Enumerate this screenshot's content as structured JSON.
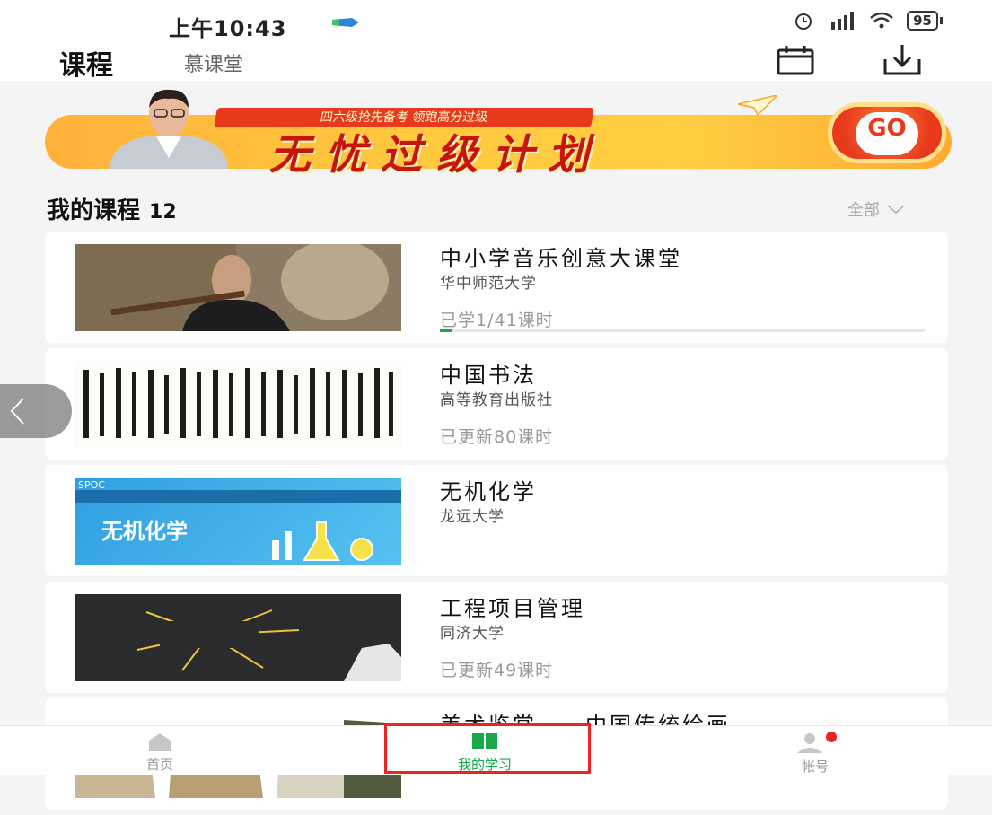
{
  "status_bar": {
    "time": "上午10:43",
    "battery": "95"
  },
  "header": {
    "title": "课程",
    "subtitle": "慕课堂"
  },
  "banner": {
    "tagline": "四六级抢先备考 领跑高分过级",
    "headline": "无忧过级计划",
    "go_label": "GO",
    "go_arrows": ">>>>"
  },
  "section": {
    "title": "我的课程",
    "count": "12",
    "filter_label": "全部"
  },
  "courses": [
    {
      "title": "中小学音乐创意大课堂",
      "school": "华中师范大学",
      "progress_text": "已学1/41课时",
      "progress": 0.024
    },
    {
      "title": "中国书法",
      "school": "高等教育出版社",
      "progress_text": "已更新80课时"
    },
    {
      "title": "无机化学",
      "school": "龙远大学",
      "progress_text": "",
      "thumb_badge": "SPOC",
      "thumb_text": "无机化学"
    },
    {
      "title": "工程项目管理",
      "school": "同济大学",
      "progress_text": "已更新49课时"
    },
    {
      "title": "美术鉴赏——中国传统绘画...",
      "school": "",
      "progress_text": ""
    }
  ],
  "bottom_nav": {
    "home": "首页",
    "study": "我的学习",
    "account": "帐号"
  },
  "colors": {
    "accent": "#19a84b",
    "highlight": "#e8261f",
    "banner_orange": "#ffc83d"
  }
}
